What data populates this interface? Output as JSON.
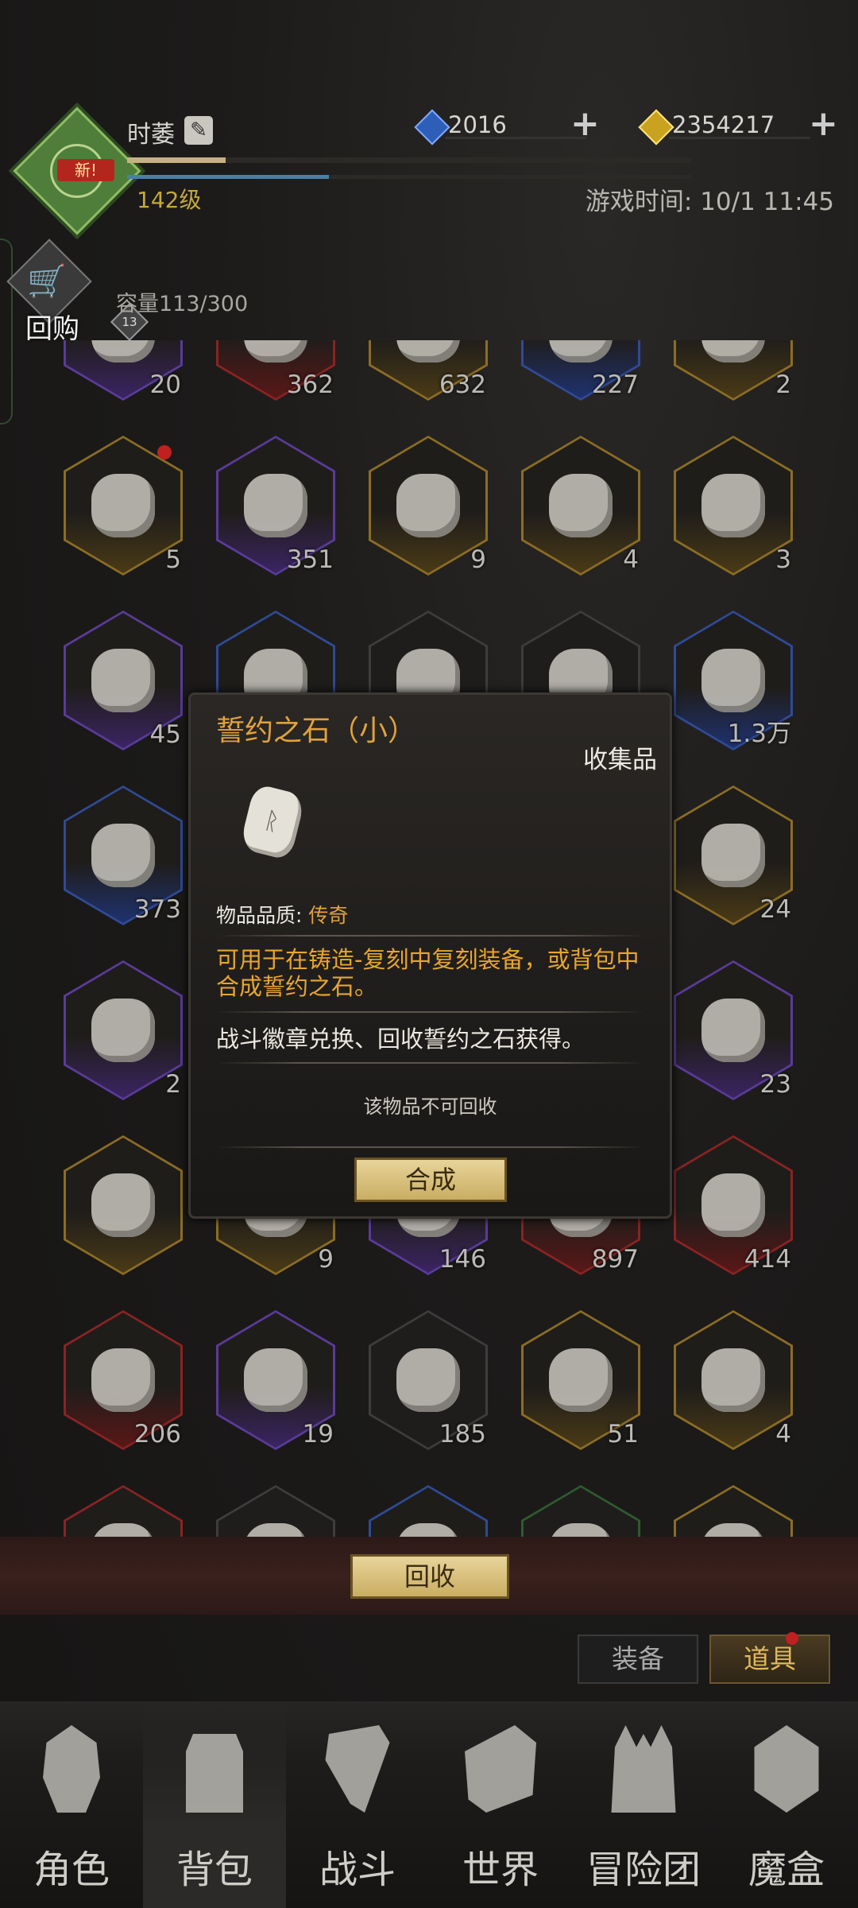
{
  "player": {
    "name": "时萎",
    "level": "142级",
    "level_badge": "13",
    "new_badge": "新!"
  },
  "currency": {
    "diamonds": "2016",
    "gold": "2354217"
  },
  "game_time": "游戏时间: 10/1 11:45",
  "buyback_label": "回购",
  "capacity": "容量113/300",
  "inventory": [
    {
      "count": "20",
      "quality": "purple"
    },
    {
      "count": "362",
      "quality": "red"
    },
    {
      "count": "632",
      "quality": "gold"
    },
    {
      "count": "227",
      "quality": "blue"
    },
    {
      "count": "2",
      "quality": "gold"
    },
    {
      "count": "5",
      "quality": "gold",
      "dot": true
    },
    {
      "count": "351",
      "quality": "purple"
    },
    {
      "count": "9",
      "quality": "gold"
    },
    {
      "count": "4",
      "quality": "gold"
    },
    {
      "count": "3",
      "quality": "gold"
    },
    {
      "count": "45",
      "quality": "purple"
    },
    {
      "count": "",
      "quality": "blue"
    },
    {
      "count": "",
      "quality": "gray"
    },
    {
      "count": "",
      "quality": "gray"
    },
    {
      "count": "1.3万",
      "quality": "blue"
    },
    {
      "count": "373",
      "quality": "blue"
    },
    {
      "count": "",
      "quality": "gray"
    },
    {
      "count": "",
      "quality": "gray"
    },
    {
      "count": "",
      "quality": "gray"
    },
    {
      "count": "24",
      "quality": "gold"
    },
    {
      "count": "2",
      "quality": "purple"
    },
    {
      "count": "",
      "quality": "gray"
    },
    {
      "count": "",
      "quality": "gray"
    },
    {
      "count": "",
      "quality": "gray"
    },
    {
      "count": "23",
      "quality": "purple"
    },
    {
      "count": "",
      "quality": "gold"
    },
    {
      "count": "9",
      "quality": "gold"
    },
    {
      "count": "146",
      "quality": "purple"
    },
    {
      "count": "897",
      "quality": "red"
    },
    {
      "count": "414",
      "quality": "red"
    },
    {
      "count": "206",
      "quality": "red"
    },
    {
      "count": "19",
      "quality": "purple"
    },
    {
      "count": "185",
      "quality": "gray"
    },
    {
      "count": "51",
      "quality": "gold"
    },
    {
      "count": "4",
      "quality": "gold"
    },
    {
      "count": "",
      "quality": "red"
    },
    {
      "count": "",
      "quality": "gray"
    },
    {
      "count": "",
      "quality": "blue"
    },
    {
      "count": "",
      "quality": "green"
    },
    {
      "count": "",
      "quality": "gold"
    }
  ],
  "recycle_button": "回收",
  "tabs": {
    "equipment": "装备",
    "items": "道具"
  },
  "nav": [
    {
      "label": "角色",
      "icon": "helmet-icon"
    },
    {
      "label": "背包",
      "icon": "backpack-icon"
    },
    {
      "label": "战斗",
      "icon": "sword-shield-icon"
    },
    {
      "label": "世界",
      "icon": "map-icon"
    },
    {
      "label": "冒险团",
      "icon": "castle-icon"
    },
    {
      "label": "魔盒",
      "icon": "cube-icon"
    }
  ],
  "popup": {
    "title": "誓约之石（小）",
    "type": "收集品",
    "quality_label": "物品品质: ",
    "quality_value": "传奇",
    "description": "可用于在铸造-复刻中复刻装备，或背包中合成誓约之石。",
    "source": "战斗徽章兑换、回收誓约之石获得。",
    "no_recycle": "该物品不可回收",
    "craft_button": "合成"
  }
}
